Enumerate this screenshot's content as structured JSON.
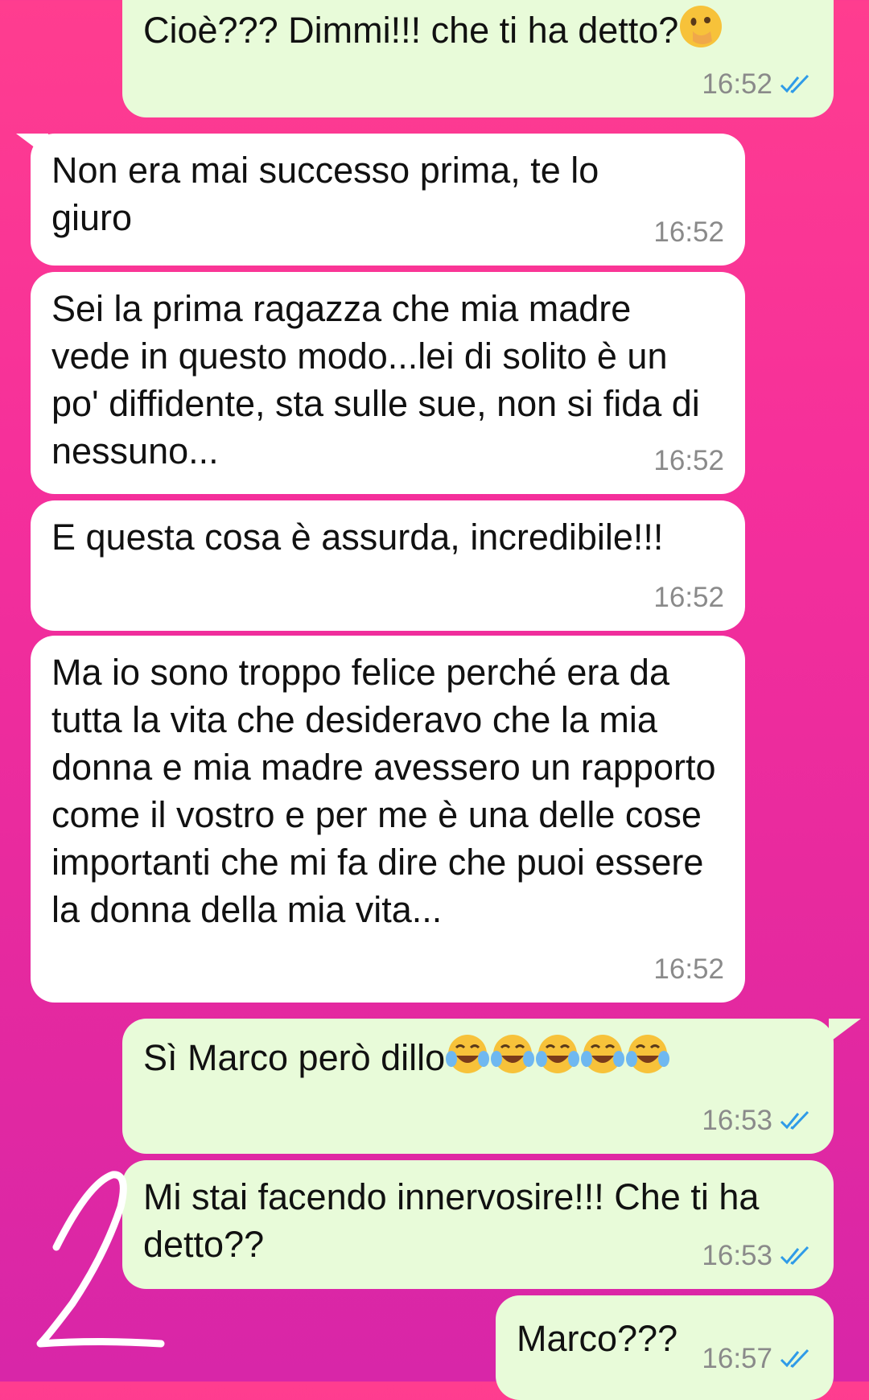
{
  "messages": [
    {
      "id": "m1",
      "dir": "out",
      "text": "Cioè??? Dimmi!!! che ti ha detto?",
      "emoji": "face-with-hand-over-mouth",
      "time": "16:52",
      "status": "read"
    },
    {
      "id": "m2",
      "dir": "in",
      "text": "Non era mai successo prima, te lo giuro",
      "time": "16:52"
    },
    {
      "id": "m3",
      "dir": "in",
      "text": "Sei la prima ragazza che mia madre vede in questo modo...lei di solito è un po' diffidente, sta sulle sue, non si fida di nessuno...",
      "time": "16:52"
    },
    {
      "id": "m4",
      "dir": "in",
      "text": "E questa cosa è assurda, incredibile!!!",
      "time": "16:52"
    },
    {
      "id": "m5",
      "dir": "in",
      "text": "Ma io sono troppo felice perché era da tutta la vita che desideravo che la mia donna e mia madre avessero un rapporto come il vostro e per me è una delle cose importanti che mi fa dire che puoi essere la donna della mia vita...",
      "time": "16:52"
    },
    {
      "id": "m6",
      "dir": "out",
      "text": "Sì Marco però dillo",
      "emoji": "face-with-tears-of-joy x5",
      "time": "16:53",
      "status": "read"
    },
    {
      "id": "m7",
      "dir": "out",
      "text": "Mi stai facendo innervosire!!! Che ti ha detto??",
      "time": "16:53",
      "status": "read"
    },
    {
      "id": "m8",
      "dir": "out",
      "text": "Marco???",
      "time": "16:57",
      "status": "read"
    }
  ],
  "colors": {
    "incoming_bubble": "#ffffff",
    "outgoing_bubble": "#e8fbd9",
    "read_tick": "#2f9be8",
    "timestamp": "#8a8a8a",
    "background": "#f0309a"
  },
  "overlay": {
    "scribble": "handwritten-2"
  }
}
